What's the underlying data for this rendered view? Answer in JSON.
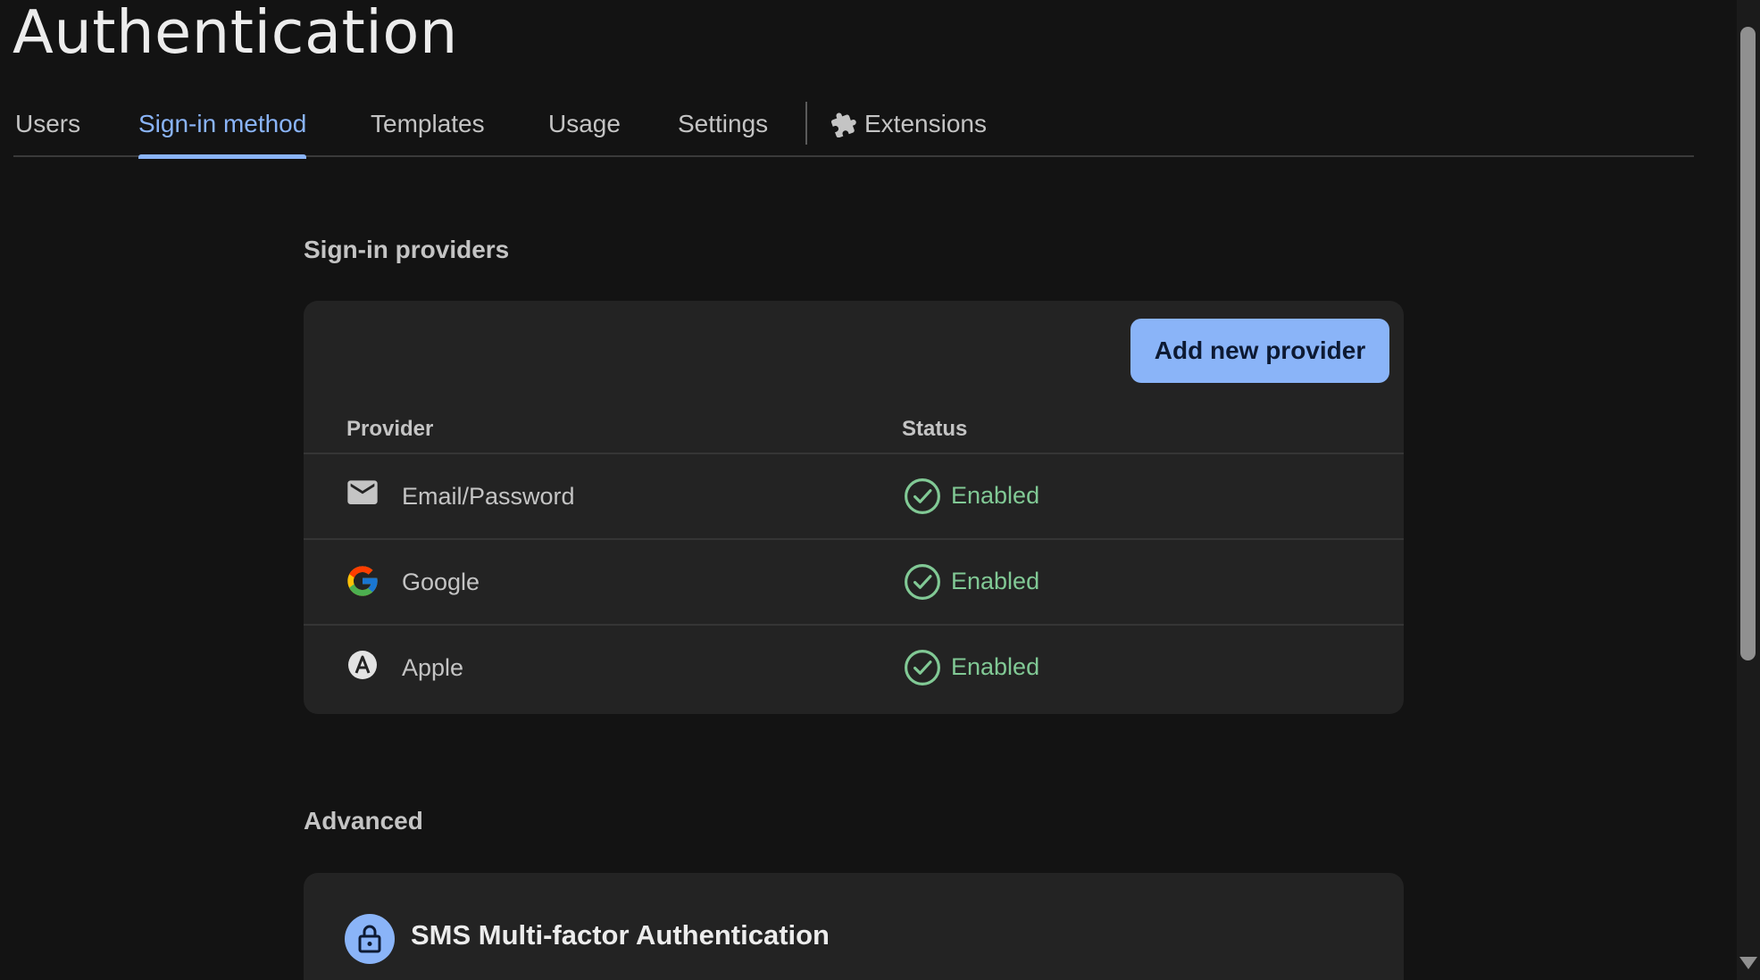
{
  "page": {
    "title": "Authentication"
  },
  "tabs": [
    {
      "label": "Users"
    },
    {
      "label": "Sign-in method",
      "active": true
    },
    {
      "label": "Templates"
    },
    {
      "label": "Usage"
    },
    {
      "label": "Settings"
    },
    {
      "label": "Extensions",
      "icon": "puzzle-piece-icon"
    }
  ],
  "providers_section": {
    "title": "Sign-in providers",
    "add_button": "Add new provider",
    "columns": {
      "provider": "Provider",
      "status": "Status"
    },
    "rows": [
      {
        "name": "Email/Password",
        "icon": "email-icon",
        "status": "Enabled"
      },
      {
        "name": "Google",
        "icon": "google-icon",
        "status": "Enabled"
      },
      {
        "name": "Apple",
        "icon": "apple-icon",
        "status": "Enabled"
      }
    ]
  },
  "advanced_section": {
    "title": "Advanced",
    "items": [
      {
        "title": "SMS Multi-factor Authentication",
        "icon": "lock-icon"
      }
    ]
  },
  "colors": {
    "accent": "#8ab4f8",
    "enabled": "#81c995",
    "background": "#131313",
    "card": "#232323"
  }
}
